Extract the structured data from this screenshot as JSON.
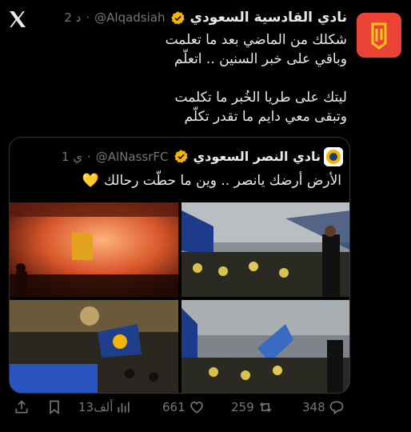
{
  "tweet": {
    "name": "نادي القادسية السعودي",
    "handle": "@Alqadsiah",
    "time": "2 د",
    "lines": [
      "شكلك من الماضي بعد ما تعلمت",
      "وباقي على خبر السنين .. اتعلّم",
      "",
      "ليتك على طريا الخُبر ما تكلمت",
      "وتبقى معي دايم ما تقدر تكلّم"
    ]
  },
  "quote": {
    "name": "نادي النصر السعودي",
    "handle": "@AlNassrFC",
    "time": "1 ي",
    "text": "الأرض أرضك يانصر .. وين ما حطّت رحالك",
    "emoji": "💛"
  },
  "actions": {
    "replies": "348",
    "retweets": "259",
    "likes": "661",
    "views": "13ألف"
  },
  "icons": [
    "x-logo-icon",
    "verified-badge-icon",
    "reply-icon",
    "retweet-icon",
    "like-icon",
    "views-icon",
    "bookmark-icon",
    "share-icon"
  ],
  "colors": {
    "accent_badge": "#f4b400",
    "qadsiah_red": "#ea4335",
    "muted": "#71767b"
  }
}
